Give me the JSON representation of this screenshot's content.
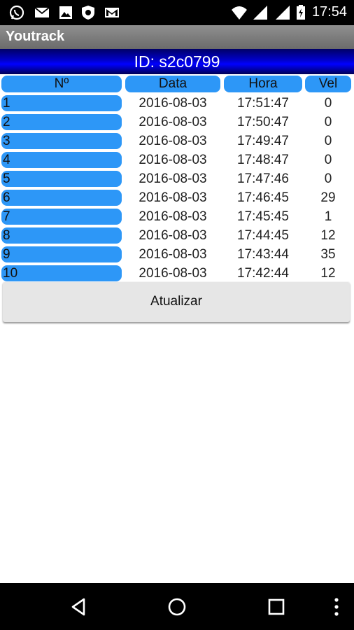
{
  "status_bar": {
    "time": "17:54",
    "left_icons": [
      "whatsapp-icon",
      "email-icon",
      "image-icon",
      "shield-icon",
      "gmail-icon"
    ],
    "right_icons": [
      "wifi-icon",
      "signal-icon",
      "battery-charging-icon"
    ]
  },
  "app": {
    "title": "Youtrack"
  },
  "device": {
    "id_label": "ID: s2c0799"
  },
  "table": {
    "headers": {
      "num": "Nº",
      "date": "Data",
      "time": "Hora",
      "speed": "Vel"
    },
    "rows": [
      {
        "num": "1",
        "date": "2016-08-03",
        "time": "17:51:47",
        "speed": "0"
      },
      {
        "num": "2",
        "date": "2016-08-03",
        "time": "17:50:47",
        "speed": "0"
      },
      {
        "num": "3",
        "date": "2016-08-03",
        "time": "17:49:47",
        "speed": "0"
      },
      {
        "num": "4",
        "date": "2016-08-03",
        "time": "17:48:47",
        "speed": "0"
      },
      {
        "num": "5",
        "date": "2016-08-03",
        "time": "17:47:46",
        "speed": "0"
      },
      {
        "num": "6",
        "date": "2016-08-03",
        "time": "17:46:45",
        "speed": "29"
      },
      {
        "num": "7",
        "date": "2016-08-03",
        "time": "17:45:45",
        "speed": "1"
      },
      {
        "num": "8",
        "date": "2016-08-03",
        "time": "17:44:45",
        "speed": "12"
      },
      {
        "num": "9",
        "date": "2016-08-03",
        "time": "17:43:44",
        "speed": "35"
      },
      {
        "num": "10",
        "date": "2016-08-03",
        "time": "17:42:44",
        "speed": "12"
      }
    ]
  },
  "actions": {
    "refresh_label": "Atualizar"
  },
  "nav_bar": {
    "icons": [
      "back-icon",
      "home-icon",
      "recents-icon",
      "more-options-icon"
    ]
  },
  "colors": {
    "cell_blue": "#2d97f7",
    "id_bar_blue": "#0000ff",
    "app_bar_gray": "#7a7a7a"
  }
}
